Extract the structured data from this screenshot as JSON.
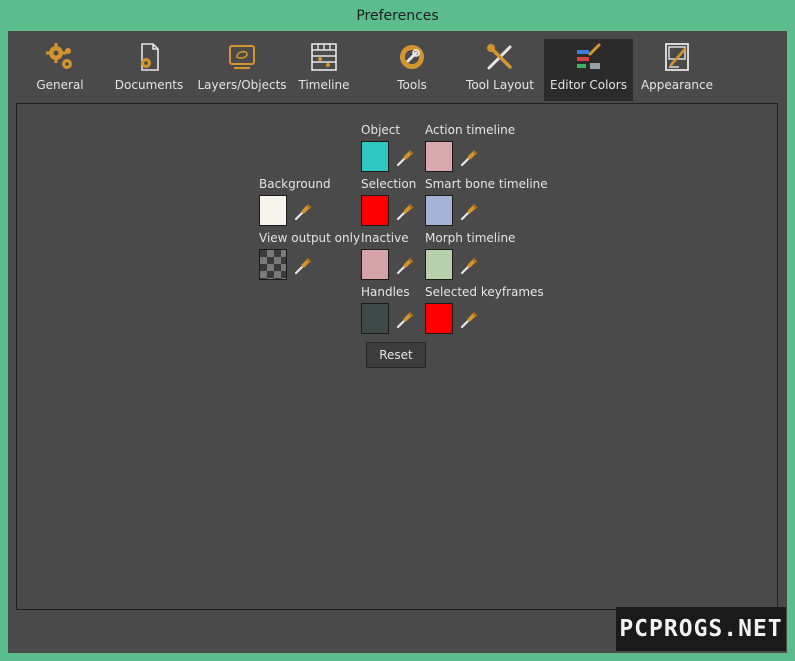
{
  "window": {
    "title": "Preferences"
  },
  "tabs": [
    {
      "label": "General",
      "icon": "gears-icon"
    },
    {
      "label": "Documents",
      "icon": "document-gear-icon"
    },
    {
      "label": "Layers/Objects",
      "icon": "layers-objects-icon"
    },
    {
      "label": "Timeline",
      "icon": "timeline-icon"
    },
    {
      "label": "Tools",
      "icon": "wrench-icon"
    },
    {
      "label": "Tool Layout",
      "icon": "tool-layout-icon"
    },
    {
      "label": "Editor Colors",
      "icon": "editor-colors-icon",
      "selected": true
    },
    {
      "label": "Appearance",
      "icon": "appearance-icon"
    }
  ],
  "colors": {
    "background": {
      "label": "Background",
      "color": "#f5f5eb"
    },
    "view_output_only": {
      "label": "View output only",
      "color": "checkerboard"
    },
    "object": {
      "label": "Object",
      "color": "#2ec8c0"
    },
    "selection": {
      "label": "Selection",
      "color": "#ff0000"
    },
    "inactive": {
      "label": "Inactive",
      "color": "#d4a4a8"
    },
    "handles": {
      "label": "Handles",
      "color": "#3f4a48"
    },
    "action_timeline": {
      "label": "Action timeline",
      "color": "#d8aab0"
    },
    "smart_bone_timeline": {
      "label": "Smart bone timeline",
      "color": "#a5b3d6"
    },
    "morph_timeline": {
      "label": "Morph timeline",
      "color": "#b8cfac"
    },
    "selected_keyframes": {
      "label": "Selected keyframes",
      "color": "#ff0000"
    }
  },
  "reset_label": "Reset",
  "watermark": "PCPROGS.NET",
  "theme": {
    "accent_frame": "#5bbd8b",
    "icon_orange": "#d4952f",
    "panel_bg": "#4a4a4a"
  }
}
